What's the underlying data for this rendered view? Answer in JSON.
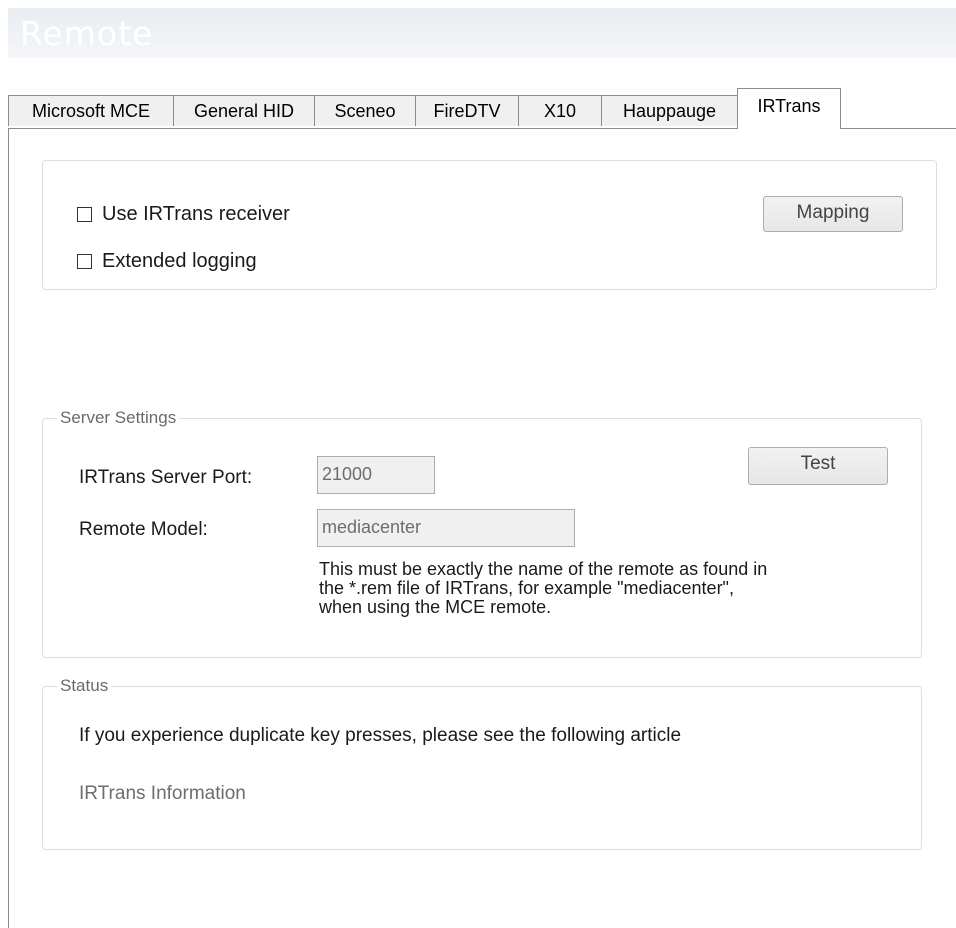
{
  "window": {
    "title": "Remote"
  },
  "tabs": [
    {
      "label": "Microsoft MCE"
    },
    {
      "label": "General HID"
    },
    {
      "label": "Sceneo"
    },
    {
      "label": "FireDTV"
    },
    {
      "label": "X10"
    },
    {
      "label": "Hauppauge"
    },
    {
      "label": "IRTrans"
    }
  ],
  "active_tab": "IRTrans",
  "receiver_group": {
    "use_receiver_label": "Use IRTrans receiver",
    "use_receiver_checked": false,
    "extended_logging_label": "Extended logging",
    "extended_logging_checked": false,
    "mapping_button": "Mapping"
  },
  "server_settings": {
    "legend": "Server Settings",
    "port_label": "IRTrans Server Port:",
    "port_value": "21000",
    "model_label": "Remote Model:",
    "model_value": "mediacenter",
    "test_button": "Test",
    "hint_line1": "This must be exactly the name of the remote as found in",
    "hint_line2": "the *.rem file of IRTrans, for example \"mediacenter\",",
    "hint_line3": "when using the MCE remote."
  },
  "status": {
    "legend": "Status",
    "message": "If you experience duplicate key presses, please see the following article",
    "link": "IRTrans Information"
  }
}
